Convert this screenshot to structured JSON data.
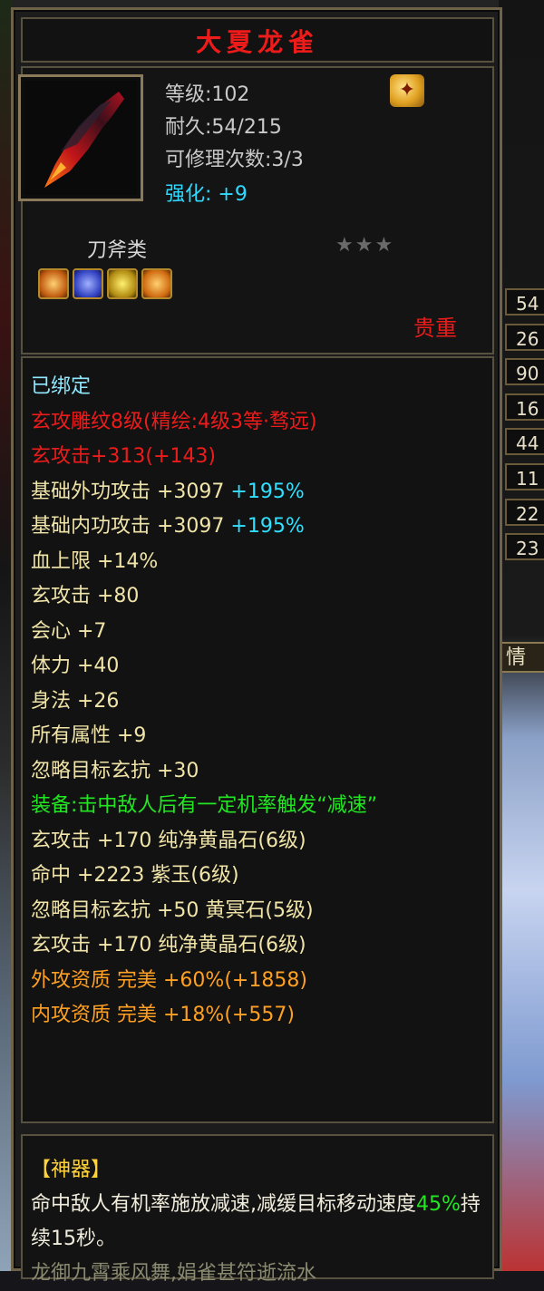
{
  "sidebar_values": [
    "54",
    "26",
    "90",
    "16",
    "44",
    "11",
    "22",
    "23"
  ],
  "side_tab": "情",
  "item": {
    "name": "大夏龙雀",
    "level": "等级:102",
    "durability": "耐久:54/215",
    "repair": "可修理次数:3/3",
    "enhance_label": "强化:",
    "enhance_value": "+9",
    "category": "刀斧类",
    "stars": "★★★",
    "gem_icons": [
      "orange-gem-icon",
      "blue-gem-icon",
      "yellow-gem-icon",
      "orange-gem-icon"
    ],
    "valuable": "贵重"
  },
  "attributes": [
    {
      "text": "已绑定",
      "color": "cyan"
    },
    {
      "text": "玄攻雕纹8级(精绘:4级3等·骛远)",
      "color": "red"
    },
    {
      "text": "玄攻击+313(+143)",
      "color": "red"
    },
    {
      "text": "基础外功攻击 +3097",
      "extra": "+195%",
      "color": "beige"
    },
    {
      "text": "基础内功攻击 +3097",
      "extra": "+195%",
      "color": "beige"
    },
    {
      "text": "血上限 +14%",
      "color": "beige"
    },
    {
      "text": "玄攻击 +80",
      "color": "beige"
    },
    {
      "text": "会心 +7",
      "color": "beige"
    },
    {
      "text": "体力 +40",
      "color": "beige"
    },
    {
      "text": "身法 +26",
      "color": "beige"
    },
    {
      "text": "所有属性 +9",
      "color": "beige"
    },
    {
      "text": "忽略目标玄抗 +30",
      "color": "beige"
    },
    {
      "text": "装备:击中敌人后有一定机率触发“减速”",
      "color": "green"
    },
    {
      "text": "玄攻击 +170 纯净黄晶石(6级)",
      "color": "beige"
    },
    {
      "text": "命中 +2223 紫玉(6级)",
      "color": "beige"
    },
    {
      "text": "忽略目标玄抗 +50 黄冥石(5级)",
      "color": "beige"
    },
    {
      "text": "玄攻击 +170 纯净黄晶石(6级)",
      "color": "beige"
    },
    {
      "text": "外攻资质  完美 +60%(+1858)",
      "color": "orange"
    },
    {
      "text": "内攻资质  完美 +18%(+557)",
      "color": "orange"
    }
  ],
  "artifact": {
    "tag": "【神器】",
    "desc_a": "命中敌人有机率施放减速,减缓目标移动速度",
    "desc_pct": "45%",
    "desc_b": "持续15秒。",
    "desc_cut": "龙御九霄乘风舞,娟雀甚符逝流水"
  }
}
